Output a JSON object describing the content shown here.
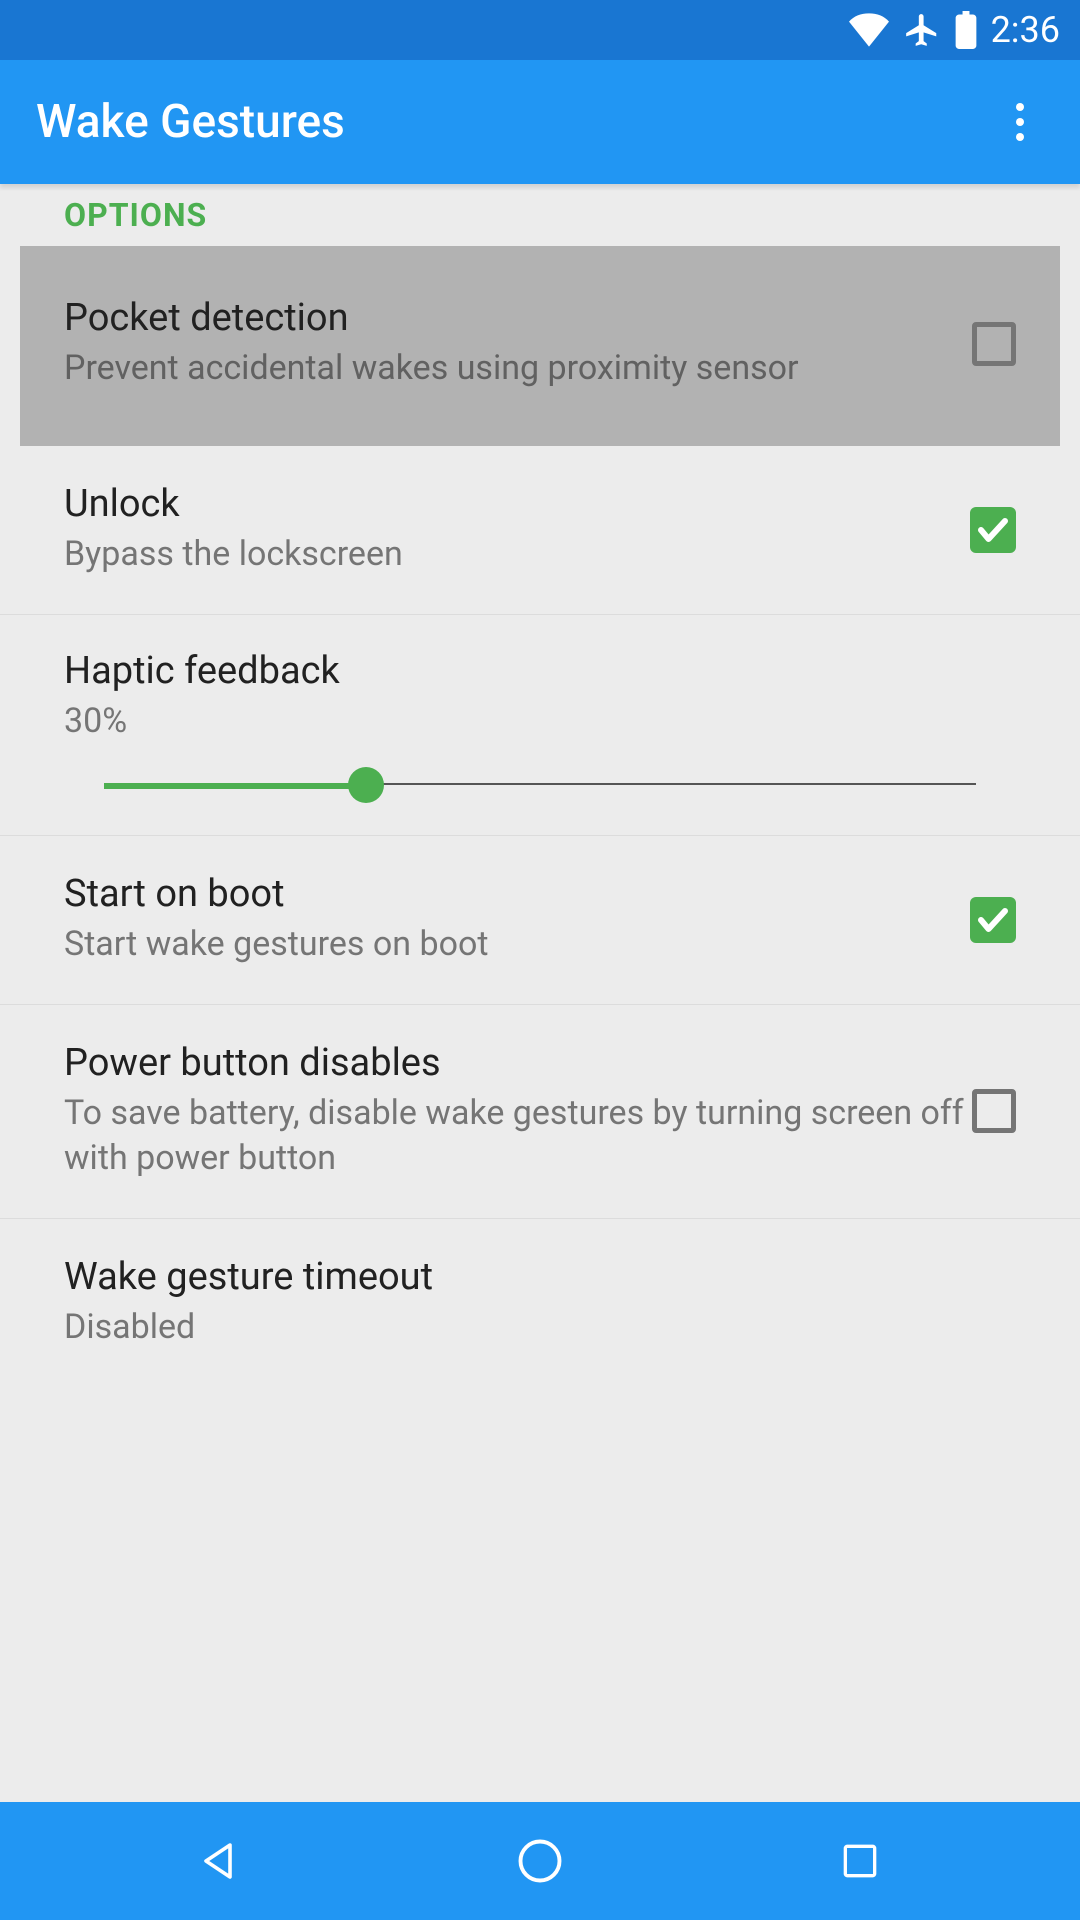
{
  "status": {
    "time": "2:36"
  },
  "header": {
    "title": "Wake Gestures"
  },
  "section": {
    "label": "OPTIONS"
  },
  "options": {
    "pocket": {
      "title": "Pocket detection",
      "subtitle": "Prevent accidental wakes using proximity sensor",
      "checked": false
    },
    "unlock": {
      "title": "Unlock",
      "subtitle": "Bypass the lockscreen",
      "checked": true
    },
    "haptic": {
      "title": "Haptic feedback",
      "value_text": "30%",
      "percent": 30
    },
    "boot": {
      "title": "Start on boot",
      "subtitle": "Start wake gestures on boot",
      "checked": true
    },
    "power": {
      "title": "Power button disables",
      "subtitle": "To save battery, disable wake gestures by turning screen off with power button",
      "checked": false
    },
    "timeout": {
      "title": "Wake gesture timeout",
      "subtitle": "Disabled"
    }
  },
  "colors": {
    "primary": "#2196f3",
    "primary_dark": "#1976d2",
    "accent": "#4caf50",
    "text_primary": "#212121",
    "text_secondary": "#757575"
  }
}
